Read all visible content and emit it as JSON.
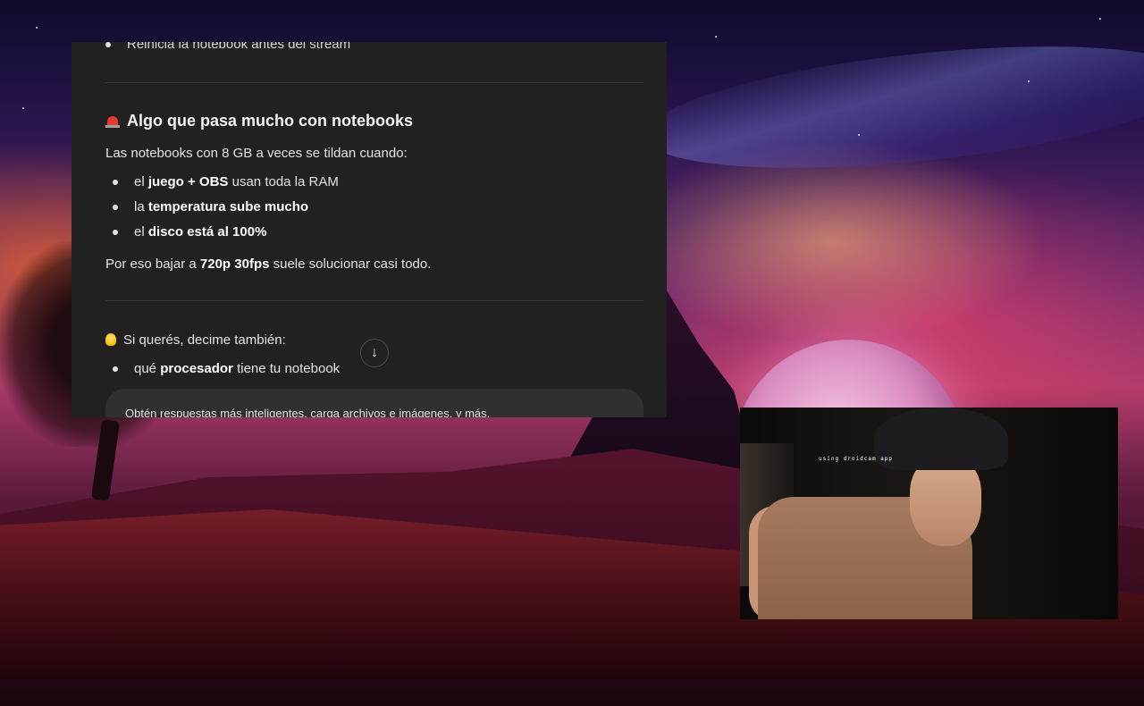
{
  "chat": {
    "cut_top_line": "Reinicia la notebook antes del stream",
    "section_heading": "Algo que pasa mucho con notebooks",
    "intro": "Las notebooks con 8 GB a veces se tildan cuando:",
    "items": [
      {
        "pre": "el ",
        "bold": "juego + OBS",
        "post": " usan toda la RAM"
      },
      {
        "pre": "la ",
        "bold": "temperatura sube mucho",
        "post": ""
      },
      {
        "pre": "el ",
        "bold": "disco está al 100%",
        "post": ""
      }
    ],
    "conclusion": {
      "pre": "Por eso bajar a ",
      "bold": "720p 30fps",
      "post": " suele solucionar casi todo."
    },
    "followup": "Si querés, decime también:",
    "followup_items": [
      {
        "pre": "qué ",
        "bold": "procesador",
        "post": " tiene tu notebook"
      }
    ],
    "composer_hint": "Obtén respuestas más inteligentes, carga archivos e imágenes, y más.",
    "scroll_icon": "arrow-down-icon",
    "heading_icon": "siren-emoji",
    "followup_icon": "lightbulb-emoji"
  },
  "webcam": {
    "watermark": "using droidcam app"
  }
}
